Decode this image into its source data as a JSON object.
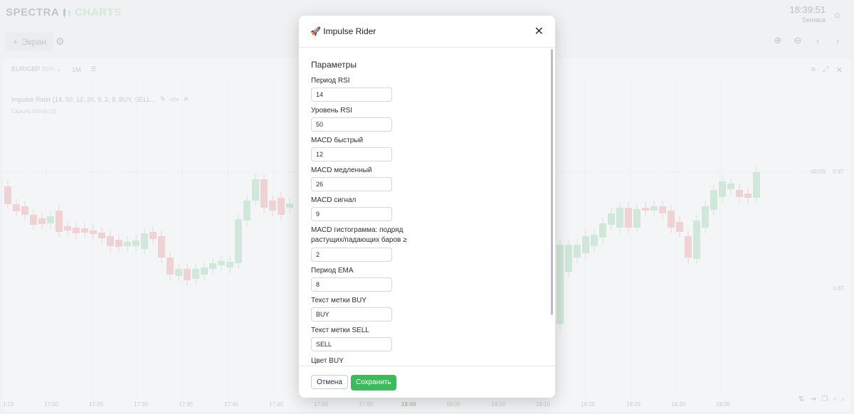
{
  "header": {
    "logo_left": "SPECTRA",
    "logo_right": "CHARTS",
    "time": "18:39:51",
    "subtitle": "Semaca"
  },
  "toolbar": {
    "screen_label": "Экран"
  },
  "chart_panel": {
    "symbol": "EUR/GBP",
    "symbol_pct": "85%",
    "timeframe": "1M",
    "indicator_line": "Impulse Rider (14, 50, 12, 26, 9, 2, 8, BUY, SELL...",
    "hide_bots": "Скрыть ботов (1)",
    "price_labels": {
      "countdown": "00:09",
      "price_top": "0.87",
      "price_mid": "0.87"
    },
    "time_labels": [
      "1:15",
      "17:20",
      "17:25",
      "17:30",
      "17:35",
      "17:40",
      "17:45",
      "17:50",
      "17:55",
      "18:00",
      "18:05",
      "18:10",
      "18:15",
      "18:20",
      "18:25",
      "18:30",
      "18:35"
    ],
    "signal_labels": {
      "buy": "BUY",
      "sell": "SELL"
    }
  },
  "modal": {
    "title": "🚀 Impulse Rider",
    "section": "Параметры",
    "fields": [
      {
        "label": "Период RSI",
        "value": "14"
      },
      {
        "label": "Уровень RSI",
        "value": "50"
      },
      {
        "label": "MACD быстрый",
        "value": "12"
      },
      {
        "label": "MACD медленный",
        "value": "26"
      },
      {
        "label": "MACD сигнал",
        "value": "9"
      },
      {
        "label": "MACD гистограмма: подряд растущих/падающих баров ≥",
        "value": "2"
      },
      {
        "label": "Период EMA",
        "value": "8"
      },
      {
        "label": "Текст метки BUY",
        "value": "BUY"
      },
      {
        "label": "Текст метки SELL",
        "value": "SELL"
      }
    ],
    "next_label": "Цвет BUY",
    "cancel_label": "Отмена",
    "save_label": "Сохранить"
  },
  "colors": {
    "up": "#b9dfc3",
    "down": "#efb8b8",
    "accent": "#3dbb5a"
  }
}
